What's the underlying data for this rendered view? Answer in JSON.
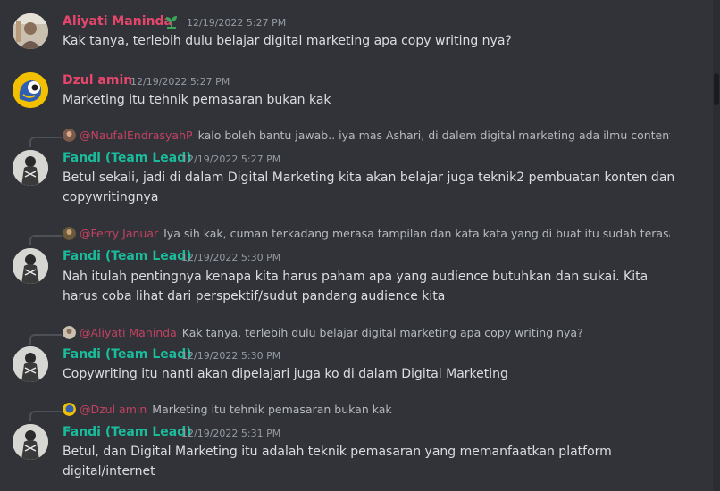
{
  "colors": {
    "bg": "#313338",
    "pink": "#e7466c",
    "teal": "#1abc9c",
    "text": "#dbdee1",
    "muted": "#949ba4",
    "fandi_avatar_bg": "#d6d7d2",
    "aliyati_avatar_bg": "#c9c0b0",
    "dzul_avatar_bg": "#f2c000"
  },
  "messages": [
    {
      "author": "Aliyati Maninda",
      "badge_icon": "sprout-icon",
      "time": "12/19/2022 5:27 PM",
      "text": "Kak tanya, terlebih dulu belajar digital marketing apa copy writing nya?"
    },
    {
      "author": "Dzul amin",
      "time": "12/19/2022 5:27 PM",
      "text": "Marketing itu tehnik pemasaran bukan kak"
    },
    {
      "author": "Fandi (Team Lead)",
      "time": "12/19/2022 5:27 PM",
      "reply": {
        "mention": "@NaufalEndrasyahP",
        "text": "kalo  boleh bantu jawab.. iya mas Ashari, di dalem digital marketing ada ilmu content writi"
      },
      "text": "Betul sekali, jadi di dalam Digital Marketing kita akan belajar juga teknik2 pembuatan konten dan copywritingnya"
    },
    {
      "author": "Fandi (Team Lead)",
      "time": "12/19/2022 5:30 PM",
      "reply": {
        "mention": "@Ferry Januar",
        "text": "Iya sih kak, cuman terkadang merasa tampilan dan kata kata yang di buat itu sudah terasa unik d"
      },
      "text": "Nah itulah pentingnya kenapa kita harus paham apa yang audience butuhkan dan sukai. Kita harus coba lihat dari perspektif/sudut pandang audience kita"
    },
    {
      "author": "Fandi (Team Lead)",
      "time": "12/19/2022 5:30 PM",
      "reply": {
        "mention": "@Aliyati Maninda",
        "text": "Kak tanya, terlebih dulu belajar digital marketing apa copy writing nya?"
      },
      "text": "Copywriting itu nanti akan dipelajari juga ko di dalam Digital Marketing"
    },
    {
      "author": "Fandi (Team Lead)",
      "time": "12/19/2022 5:31 PM",
      "reply": {
        "mention": "@Dzul amin",
        "text": "Marketing itu tehnik pemasaran bukan kak"
      },
      "text": "Betul, dan Digital Marketing itu adalah teknik pemasaran yang memanfaatkan platform digital/internet"
    }
  ]
}
